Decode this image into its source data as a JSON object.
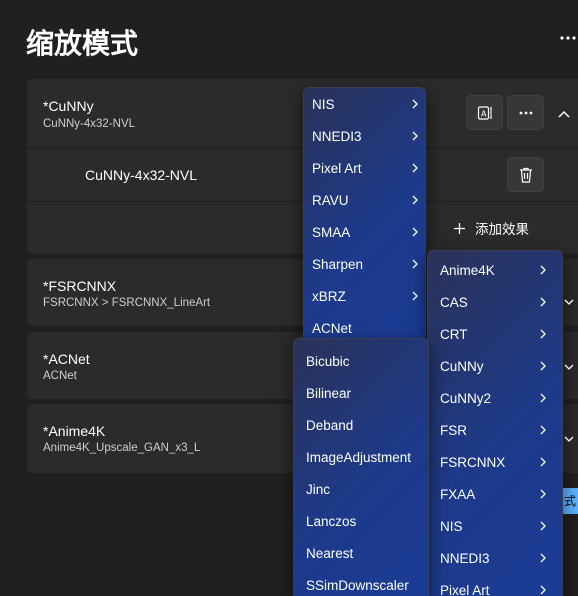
{
  "page": {
    "title": "缩放模式"
  },
  "cards": [
    {
      "title": "*CuNNy",
      "subtitle": "CuNNy-4x32-NVL",
      "effect_label": "CuNNy-4x32-NVL",
      "add_effect_label": "添加效果"
    },
    {
      "title": "*FSRCNNX",
      "subtitle": "FSRCNNX > FSRCNNX_LineArt"
    },
    {
      "title": "*ACNet",
      "subtitle": "ACNet"
    },
    {
      "title": "*Anime4K",
      "subtitle": "Anime4K_Upscale_GAN_x3_L"
    }
  ],
  "menu_main": {
    "items": [
      {
        "label": "NIS",
        "submenu": true
      },
      {
        "label": "NNEDI3",
        "submenu": true
      },
      {
        "label": "Pixel Art",
        "submenu": true
      },
      {
        "label": "RAVU",
        "submenu": true
      },
      {
        "label": "SMAA",
        "submenu": true
      },
      {
        "label": "Sharpen",
        "submenu": true
      },
      {
        "label": "xBRZ",
        "submenu": true
      },
      {
        "label": "ACNet",
        "submenu": false
      }
    ]
  },
  "menu_right": {
    "items": [
      {
        "label": "Anime4K",
        "submenu": true
      },
      {
        "label": "CAS",
        "submenu": true
      },
      {
        "label": "CRT",
        "submenu": true
      },
      {
        "label": "CuNNy",
        "submenu": true
      },
      {
        "label": "CuNNy2",
        "submenu": true
      },
      {
        "label": "FSR",
        "submenu": true
      },
      {
        "label": "FSRCNNX",
        "submenu": true
      },
      {
        "label": "FXAA",
        "submenu": true
      },
      {
        "label": "NIS",
        "submenu": true
      },
      {
        "label": "NNEDI3",
        "submenu": true
      },
      {
        "label": "Pixel Art",
        "submenu": true
      }
    ]
  },
  "menu_lower": {
    "items": [
      {
        "label": "Bicubic"
      },
      {
        "label": "Bilinear"
      },
      {
        "label": "Deband"
      },
      {
        "label": "ImageAdjustment"
      },
      {
        "label": "Jinc"
      },
      {
        "label": "Lanczos"
      },
      {
        "label": "Nearest"
      },
      {
        "label": "SSimDownscaler"
      }
    ]
  },
  "partial_chip": {
    "label": "式"
  },
  "icons": [
    "more-icon",
    "rename-icon",
    "chevron-up-icon",
    "delete-icon",
    "add-icon",
    "chevron-right-icon",
    "chevron-down-icon"
  ],
  "colors": {
    "background": "#202020",
    "card": "#2b2b2b",
    "menu_blue": "#1d3a8a",
    "accent": "#5cb4ff"
  }
}
